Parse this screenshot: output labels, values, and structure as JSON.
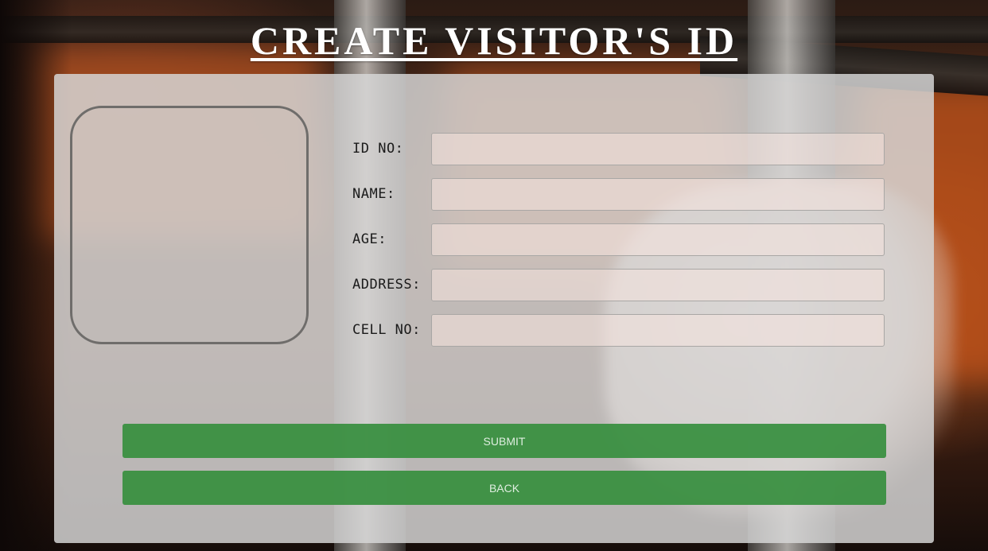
{
  "page": {
    "title": "CREATE VISITOR'S ID"
  },
  "form": {
    "fields": [
      {
        "label": "ID NO:",
        "value": "",
        "placeholder": ""
      },
      {
        "label": "NAME:",
        "value": "",
        "placeholder": ""
      },
      {
        "label": "AGE:",
        "value": "",
        "placeholder": ""
      },
      {
        "label": "ADDRESS:",
        "value": "",
        "placeholder": ""
      },
      {
        "label": "CELL NO:",
        "value": "",
        "placeholder": ""
      }
    ]
  },
  "buttons": {
    "submit_label": "SUBMIT",
    "back_label": "BACK"
  },
  "colors": {
    "button_green": "#368e3e",
    "panel_gray": "#d6d6d6",
    "title_white": "#ffffff"
  }
}
